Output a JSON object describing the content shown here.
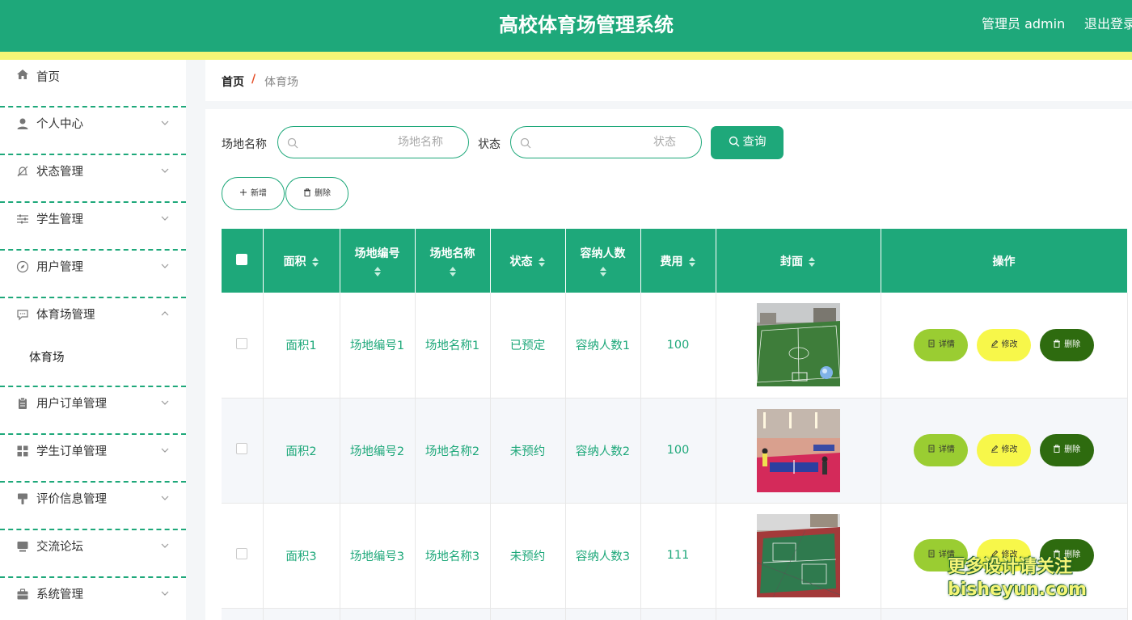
{
  "header": {
    "title": "高校体育场管理系统",
    "user": "管理员 admin",
    "logout": "退出登录"
  },
  "sidebar": {
    "items": [
      {
        "label": "首页",
        "icon": "home-icon"
      },
      {
        "label": "个人中心",
        "icon": "user-icon"
      },
      {
        "label": "状态管理",
        "icon": "bell-off-icon"
      },
      {
        "label": "学生管理",
        "icon": "sliders-icon"
      },
      {
        "label": "用户管理",
        "icon": "compass-icon"
      },
      {
        "label": "体育场管理",
        "icon": "chat-icon",
        "expanded": true,
        "children": [
          "体育场"
        ]
      },
      {
        "label": "用户订单管理",
        "icon": "clipboard-icon"
      },
      {
        "label": "学生订单管理",
        "icon": "grid-icon"
      },
      {
        "label": "评价信息管理",
        "icon": "brush-icon"
      },
      {
        "label": "交流论坛",
        "icon": "monitor-icon"
      },
      {
        "label": "系统管理",
        "icon": "briefcase-icon"
      }
    ]
  },
  "breadcrumb": {
    "home": "首页",
    "separator": "/",
    "current": "体育场"
  },
  "search": {
    "name_label": "场地名称",
    "name_placeholder": "场地名称",
    "status_label": "状态",
    "status_placeholder": "状态",
    "query_button": "查询"
  },
  "actions": {
    "add": "新增",
    "delete": "删除"
  },
  "table": {
    "headers": [
      "面积",
      "场地编号",
      "场地名称",
      "状态",
      "容纳人数",
      "费用",
      "封面",
      "操作"
    ],
    "rows": [
      {
        "area": "面积1",
        "code": "场地编号1",
        "name": "场地名称1",
        "status": "已预定",
        "capacity": "容纳人数1",
        "fee": "100",
        "cover": "football-field-image"
      },
      {
        "area": "面积2",
        "code": "场地编号2",
        "name": "场地名称2",
        "status": "未预约",
        "capacity": "容纳人数2",
        "fee": "100",
        "cover": "table-tennis-hall-image"
      },
      {
        "area": "面积3",
        "code": "场地编号3",
        "name": "场地名称3",
        "status": "未预约",
        "capacity": "容纳人数3",
        "fee": "111",
        "cover": "basketball-court-image"
      }
    ],
    "row_actions": {
      "detail": "详情",
      "edit": "修改",
      "delete": "删除"
    }
  },
  "watermark": {
    "line1": "更多设计请关注",
    "line2": "bisheyun.com"
  },
  "colors": {
    "primary": "#1ea87a",
    "accent_strip": "#f5f576",
    "detail": "#9acd32",
    "edit": "#f7f74a",
    "danger": "#2e6b0f"
  }
}
